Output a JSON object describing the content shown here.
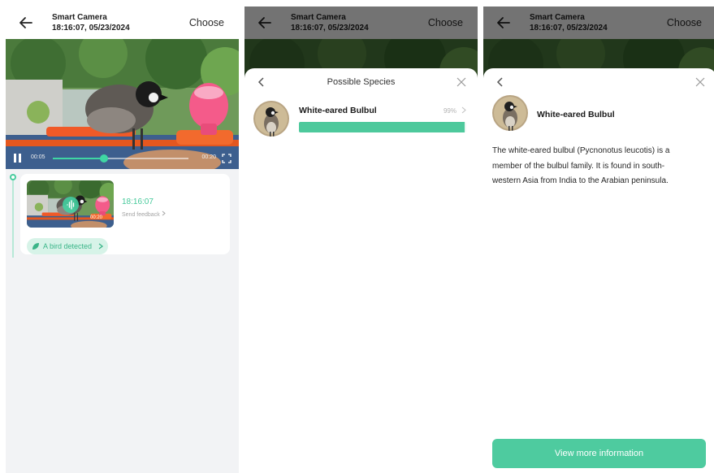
{
  "header": {
    "title": "Smart Camera",
    "timestamp": "18:16:07, 05/23/2024",
    "choose_label": "Choose"
  },
  "video": {
    "elapsed": "00:05",
    "duration": "00:20",
    "progress": 0.38
  },
  "event": {
    "thumbnail_time": "00:20",
    "time": "18:16:07",
    "feedback_label": "Send feedback",
    "detection_label": "A bird detected"
  },
  "species_sheet": {
    "title": "Possible Species",
    "species": [
      {
        "name": "White-eared Bulbul",
        "confidence_label": "99%",
        "confidence": 0.99
      }
    ]
  },
  "detail_sheet": {
    "name": "White-eared Bulbul",
    "description": "The white-eared bulbul (Pycnonotus leucotis) is a member of the bulbul family. It is found in south-western Asia from India to the Arabian peninsula.",
    "cta_label": "View more information"
  },
  "icons": {
    "back": "arrow-left-icon",
    "pause": "pause-icon",
    "fullscreen": "fullscreen-icon",
    "leaf": "leaf-icon",
    "chevron": "chevron-right-icon",
    "close": "close-icon"
  },
  "colors": {
    "accent": "#4ecb9f",
    "accent_light": "#d7f3e8",
    "background": "#f2f3f5"
  }
}
